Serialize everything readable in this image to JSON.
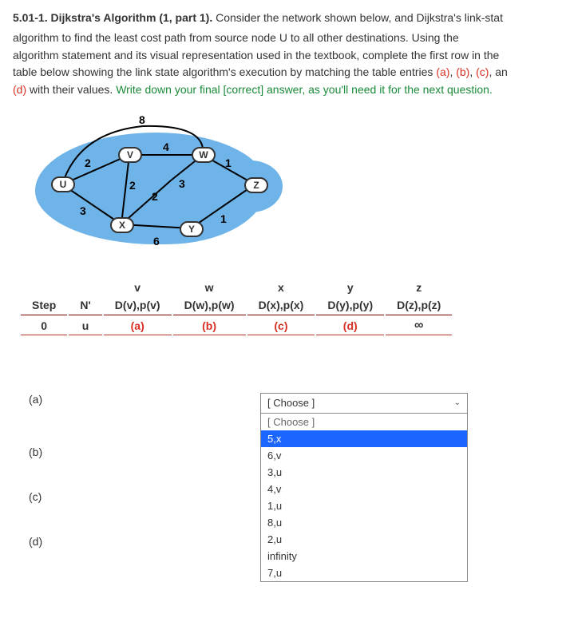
{
  "question": {
    "number": "5.01-1.",
    "title": "Dijkstra's Algorithm (1, part 1).",
    "body_part1": "Consider the network shown below, and Dijkstra's link-stat",
    "body_line2": "algorithm to find the least cost path from source node U to all other destinations.  Using the",
    "body_line3": "algorithm statement and its visual representation used in the textbook, complete the first row in the",
    "body_line4a": "table below showing the link state algorithm's execution by matching the table entries ",
    "labels": {
      "a": "(a)",
      "b": "(b)",
      "c": "(c)",
      "d": "(d)"
    },
    "body_line4b": ", an",
    "body_line5a": " with their values.  ",
    "body_line5b": "Write down your final [correct] answer, as you'll need it for the next question."
  },
  "graph": {
    "nodes": {
      "u": "U",
      "v": "V",
      "w": "W",
      "x": "X",
      "y": "Y",
      "z": "Z"
    },
    "weights": {
      "uv": "2",
      "ux": "3",
      "vw": "4",
      "vx": "2",
      "xw": "2",
      "xy": "6",
      "wy": "3",
      "wz": "1",
      "yz": "1",
      "top": "8"
    }
  },
  "table": {
    "headers": {
      "step": "Step",
      "np": "N'",
      "v": "v",
      "w": "w",
      "x": "x",
      "y": "y",
      "z": "z"
    },
    "subheaders": {
      "v": "D(v),p(v)",
      "w": "D(w),p(w)",
      "x": "D(x),p(x)",
      "y": "D(y),p(y)",
      "z": "D(z),p(z)"
    },
    "row0": {
      "step": "0",
      "np": "u",
      "a": "(a)",
      "b": "(b)",
      "c": "(c)",
      "d": "(d)",
      "z": "∞"
    }
  },
  "qa": {
    "a": "(a)",
    "b": "(b)",
    "c": "(c)",
    "d": "(d)",
    "choose": "[ Choose ]",
    "options": [
      "[ Choose ]",
      "5,x",
      "6,v",
      "3,u",
      "4,v",
      "1,u",
      "8,u",
      "2,u",
      "infinity",
      "7,u"
    ],
    "selected": "5,x"
  }
}
